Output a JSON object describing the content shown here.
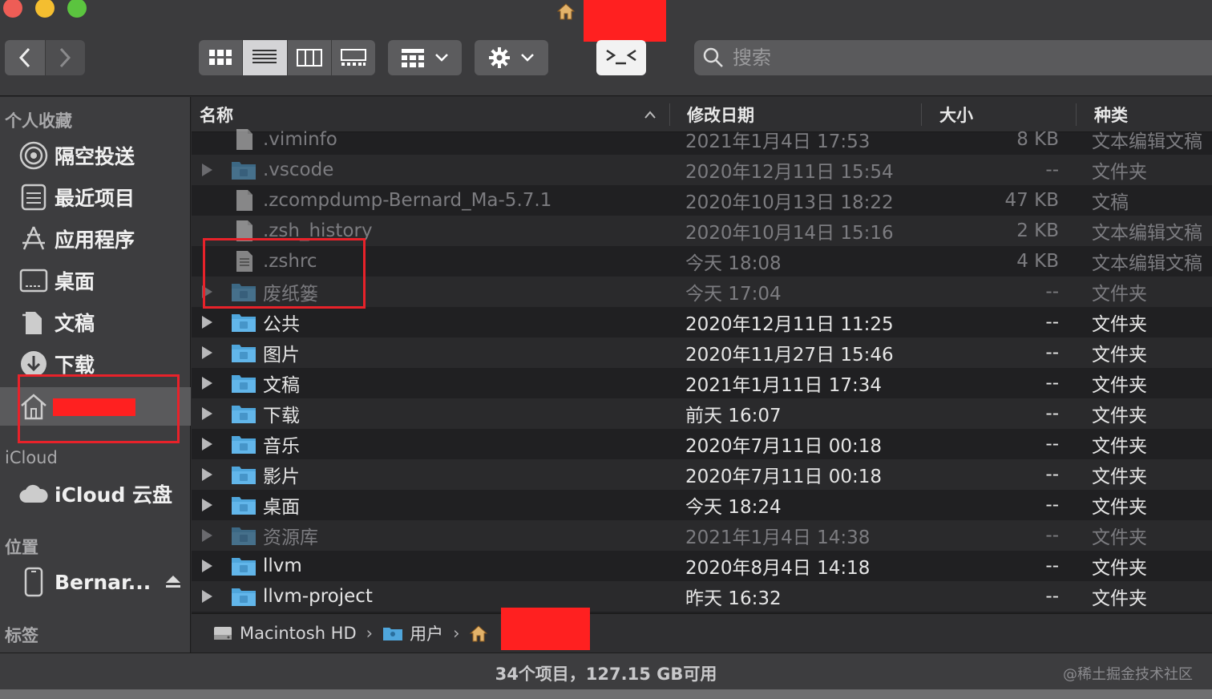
{
  "toolbar": {
    "search_placeholder": "搜索"
  },
  "sidebar": {
    "favorites_heading": "个人收藏",
    "favorites": [
      {
        "label": "隔空投送",
        "icon": "airdrop-icon"
      },
      {
        "label": "最近项目",
        "icon": "recents-icon"
      },
      {
        "label": "应用程序",
        "icon": "applications-icon"
      },
      {
        "label": "桌面",
        "icon": "desktop-icon"
      },
      {
        "label": "文稿",
        "icon": "documents-icon"
      },
      {
        "label": "下载",
        "icon": "downloads-icon"
      },
      {
        "label": "",
        "icon": "home-icon"
      }
    ],
    "icloud_heading": "iCloud",
    "icloud_drive": "iCloud 云盘",
    "locations_heading": "位置",
    "device": "Bernar...",
    "tags_heading": "标签"
  },
  "columns": {
    "name": "名称",
    "date": "修改日期",
    "size": "大小",
    "kind": "种类"
  },
  "files": [
    {
      "name": ".viminfo",
      "date": "2021年1月4日 17:53",
      "size": "8 KB",
      "kind": "文本编辑文稿",
      "type": "doc",
      "hidden": true,
      "folder": false
    },
    {
      "name": ".vscode",
      "date": "2020年12月11日 15:54",
      "size": "--",
      "kind": "文件夹",
      "type": "folder",
      "hidden": true,
      "folder": true
    },
    {
      "name": ".zcompdump-Bernard_Ma-5.7.1",
      "date": "2020年10月13日 18:22",
      "size": "47 KB",
      "kind": "文稿",
      "type": "doc",
      "hidden": true,
      "folder": false
    },
    {
      "name": ".zsh_history",
      "date": "2020年10月14日 15:16",
      "size": "2 KB",
      "kind": "文本编辑文稿",
      "type": "doc",
      "hidden": true,
      "folder": false
    },
    {
      "name": ".zshrc",
      "date": "今天 18:08",
      "size": "4 KB",
      "kind": "文本编辑文稿",
      "type": "text",
      "hidden": true,
      "folder": false
    },
    {
      "name": "废纸篓",
      "date": "今天 17:04",
      "size": "--",
      "kind": "文件夹",
      "type": "folder",
      "hidden": true,
      "folder": true
    },
    {
      "name": "公共",
      "date": "2020年12月11日 11:25",
      "size": "--",
      "kind": "文件夹",
      "type": "folder",
      "hidden": false,
      "folder": true
    },
    {
      "name": "图片",
      "date": "2020年11月27日 15:46",
      "size": "--",
      "kind": "文件夹",
      "type": "folder",
      "hidden": false,
      "folder": true
    },
    {
      "name": "文稿",
      "date": "2021年1月11日 17:34",
      "size": "--",
      "kind": "文件夹",
      "type": "folder",
      "hidden": false,
      "folder": true
    },
    {
      "name": "下载",
      "date": "前天 16:07",
      "size": "--",
      "kind": "文件夹",
      "type": "folder",
      "hidden": false,
      "folder": true
    },
    {
      "name": "音乐",
      "date": "2020年7月11日 00:18",
      "size": "--",
      "kind": "文件夹",
      "type": "folder",
      "hidden": false,
      "folder": true
    },
    {
      "name": "影片",
      "date": "2020年7月11日 00:18",
      "size": "--",
      "kind": "文件夹",
      "type": "folder",
      "hidden": false,
      "folder": true
    },
    {
      "name": "桌面",
      "date": "今天 18:24",
      "size": "--",
      "kind": "文件夹",
      "type": "folder",
      "hidden": false,
      "folder": true
    },
    {
      "name": "资源库",
      "date": "2021年1月4日 14:38",
      "size": "--",
      "kind": "文件夹",
      "type": "folder",
      "hidden": true,
      "folder": true
    },
    {
      "name": "llvm",
      "date": "2020年8月4日 14:18",
      "size": "--",
      "kind": "文件夹",
      "type": "folder",
      "hidden": false,
      "folder": true
    },
    {
      "name": "llvm-project",
      "date": "昨天 16:32",
      "size": "--",
      "kind": "文件夹",
      "type": "folder",
      "hidden": false,
      "folder": true
    }
  ],
  "pathbar": {
    "disk": "Macintosh HD",
    "users": "用户"
  },
  "status": "34个项目，127.15 GB可用",
  "watermark": "@稀土掘金技术社区",
  "colors": {
    "folder_blue": "#4fa6dc",
    "highlight_red": "#e8222a",
    "redaction_red": "#ff2020"
  }
}
